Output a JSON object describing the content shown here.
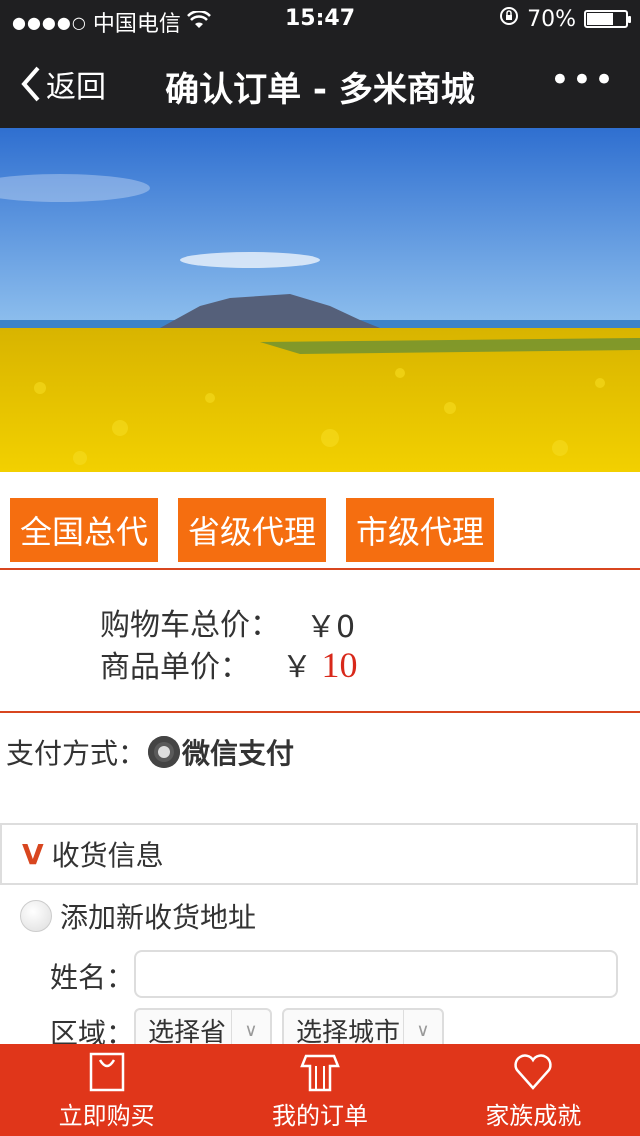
{
  "status_bar": {
    "carrier": "中国电信",
    "time": "15:47",
    "battery": "70%",
    "battery_level": 0.7
  },
  "nav": {
    "back_label": "返回",
    "title": "确认订单 - 多米商城"
  },
  "tag_buttons": [
    "全国总代",
    "省级代理",
    "市级代理"
  ],
  "prices": {
    "cart_total_label": "购物车总价：",
    "cart_total_value": "￥0",
    "unit_price_label": "商品单价：",
    "unit_price_currency": "￥",
    "unit_price_value": "10"
  },
  "payment": {
    "label": "支付方式：",
    "method": "微信支付"
  },
  "shipping": {
    "section_title": "收货信息",
    "add_address": "添加新收货地址",
    "name_label": "姓名：",
    "name_value": "",
    "area_label": "区域：",
    "province_select": "选择省",
    "city_select": "选择城市"
  },
  "tabbar": {
    "buy_now": "立即购买",
    "my_orders": "我的订单",
    "family": "家族成就"
  },
  "colors": {
    "accent": "#f56e10",
    "tabbar": "#e0361a",
    "price_red": "#d8281a",
    "divider": "#d8461f"
  }
}
